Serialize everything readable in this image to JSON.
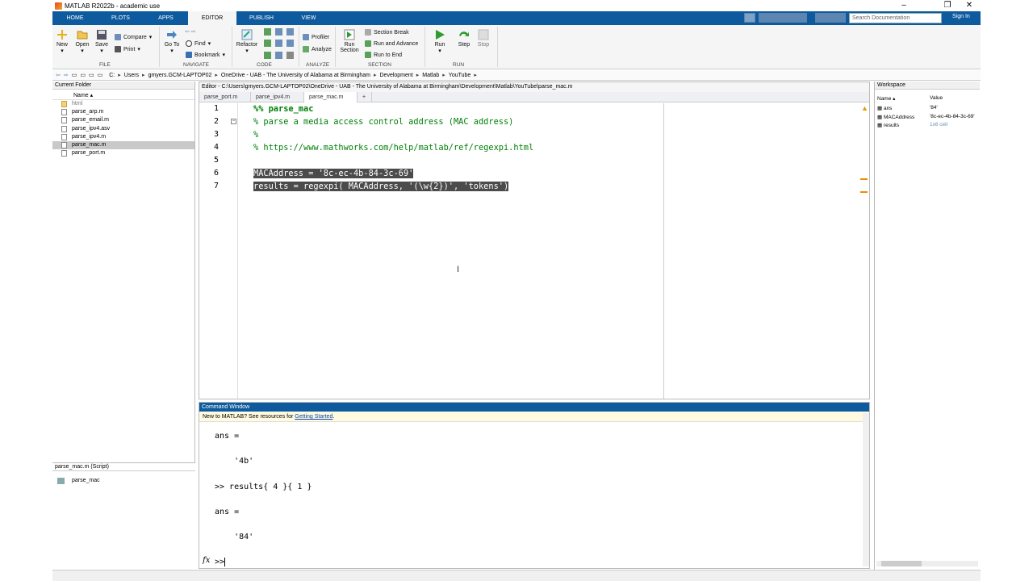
{
  "window": {
    "title": "MATLAB R2022b - academic use"
  },
  "tabs": [
    "HOME",
    "PLOTS",
    "APPS",
    "EDITOR",
    "PUBLISH",
    "VIEW"
  ],
  "active_tab": "EDITOR",
  "search": {
    "placeholder": "Search Documentation"
  },
  "signin": "Sign In",
  "ribbon": {
    "new": "New",
    "open": "Open",
    "save": "Save",
    "compare": "Compare",
    "print": "Print",
    "file_group": "FILE",
    "goto": "Go To",
    "find": "Find",
    "bookmark": "Bookmark",
    "navigate_group": "NAVIGATE",
    "refactor": "Refactor",
    "code_group": "CODE",
    "profiler": "Profiler",
    "analyze": "Analyze",
    "analyze_group": "ANALYZE",
    "section_break": "Section Break",
    "run_and_advance": "Run and Advance",
    "run_to_end": "Run to End",
    "run_section": "Run Section",
    "section_group": "SECTION",
    "run": "Run",
    "step": "Step",
    "stop": "Stop",
    "run_group": "RUN"
  },
  "address": [
    "C:",
    "Users",
    "gmyers.GCM-LAPTOP02",
    "OneDrive - UAB - The University of Alabama at Birmingham",
    "Development",
    "Matlab",
    "YouTube"
  ],
  "current_folder": {
    "title": "Current Folder",
    "header": "Name",
    "files": [
      "html",
      "parse_arp.m",
      "parse_email.m",
      "parse_ipv4.asv",
      "parse_ipv4.m",
      "parse_mac.m",
      "parse_port.m"
    ],
    "selected": "parse_mac.m"
  },
  "details": {
    "title": "parse_mac.m  (Script)",
    "item": "parse_mac"
  },
  "editor": {
    "title": "Editor - C:\\Users\\gmyers.GCM-LAPTOP02\\OneDrive - UAB - The University of Alabama at Birmingham\\Development\\Matlab\\YouTube\\parse_mac.m",
    "tabs": [
      "parse_port.m",
      "parse_ipv4.m",
      "parse_mac.m"
    ],
    "active_tab": "parse_mac.m",
    "line_numbers": [
      "1",
      "2",
      "3",
      "4",
      "5",
      "6",
      "7"
    ],
    "lines": [
      "%% parse_mac",
      "% parse a media access control address (MAC address)",
      "%",
      "% https://www.mathworks.com/help/matlab/ref/regexpi.html",
      "",
      "MACAddress = '8c-ec-4b-84-3c-69'",
      "results = regexpi( MACAddress, '(\\w{2})', 'tokens')"
    ]
  },
  "command_window": {
    "title": "Command Window",
    "notice_prefix": "New to MATLAB? See resources for ",
    "notice_link": "Getting Started",
    "notice_suffix": ".",
    "lines": [
      "ans =",
      "",
      "    '4b'",
      "",
      ">> results{ 4 }{ 1 }",
      "",
      "ans =",
      "",
      "    '84'"
    ],
    "prompt": ">>",
    "fx": "fx"
  },
  "workspace": {
    "title": "Workspace",
    "col_name": "Name",
    "col_value": "Value",
    "rows": [
      {
        "name": "ans",
        "value": "'84'"
      },
      {
        "name": "MACAddress",
        "value": "'8c-ec-4b-84-3c-69'"
      },
      {
        "name": "results",
        "value": "1x6 cell"
      }
    ]
  }
}
